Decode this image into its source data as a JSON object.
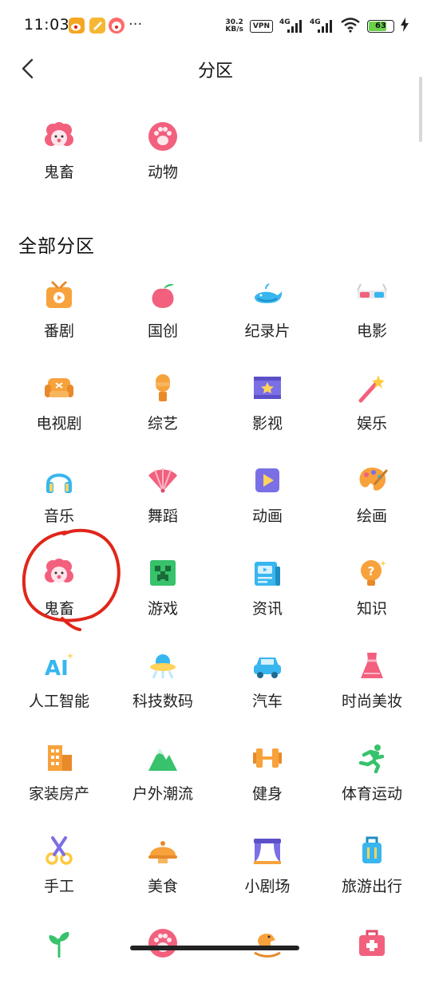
{
  "status_bar": {
    "time": "11:03",
    "more": "···",
    "net_speed_value": "30.2",
    "net_speed_unit": "KB/s",
    "vpn": "VPN",
    "signal_1": "4G",
    "signal_2": "4G",
    "battery": "63"
  },
  "header": {
    "title": "分区"
  },
  "recent": [
    {
      "label": "鬼畜",
      "icon": "ghost-clown-icon"
    },
    {
      "label": "动物",
      "icon": "paw-icon"
    }
  ],
  "all_section": {
    "title": "全部分区",
    "items": [
      {
        "label": "番剧",
        "icon": "tv-anime-icon"
      },
      {
        "label": "国创",
        "icon": "peach-icon"
      },
      {
        "label": "纪录片",
        "icon": "whale-icon"
      },
      {
        "label": "电影",
        "icon": "3d-glasses-icon"
      },
      {
        "label": "电视剧",
        "icon": "sofa-icon"
      },
      {
        "label": "综艺",
        "icon": "microphone-icon"
      },
      {
        "label": "影视",
        "icon": "film-icon"
      },
      {
        "label": "娱乐",
        "icon": "magic-wand-icon"
      },
      {
        "label": "音乐",
        "icon": "headphones-icon"
      },
      {
        "label": "舞蹈",
        "icon": "folding-fan-icon"
      },
      {
        "label": "动画",
        "icon": "play-box-icon"
      },
      {
        "label": "绘画",
        "icon": "palette-icon"
      },
      {
        "label": "鬼畜",
        "icon": "ghost-clown-icon"
      },
      {
        "label": "游戏",
        "icon": "creeper-icon"
      },
      {
        "label": "资讯",
        "icon": "newspaper-icon"
      },
      {
        "label": "知识",
        "icon": "lightbulb-icon"
      },
      {
        "label": "人工智能",
        "icon": "ai-icon"
      },
      {
        "label": "科技数码",
        "icon": "ufo-icon"
      },
      {
        "label": "汽车",
        "icon": "car-icon"
      },
      {
        "label": "时尚美妆",
        "icon": "dress-icon"
      },
      {
        "label": "家装房产",
        "icon": "building-icon"
      },
      {
        "label": "户外潮流",
        "icon": "mountain-icon"
      },
      {
        "label": "健身",
        "icon": "dumbbell-icon"
      },
      {
        "label": "体育运动",
        "icon": "runner-icon"
      },
      {
        "label": "手工",
        "icon": "scissors-icon"
      },
      {
        "label": "美食",
        "icon": "food-cloche-icon"
      },
      {
        "label": "小剧场",
        "icon": "stage-icon"
      },
      {
        "label": "旅游出行",
        "icon": "suitcase-icon"
      },
      {
        "label": "",
        "icon": "plant-icon"
      },
      {
        "label": "",
        "icon": "paw-icon"
      },
      {
        "label": "",
        "icon": "rocking-horse-icon"
      },
      {
        "label": "",
        "icon": "first-aid-icon"
      }
    ]
  },
  "colors": {
    "pink": "#f2607d",
    "orange": "#f7a23b",
    "blue": "#38b6f0",
    "purple": "#7b6fe6",
    "green": "#37c26b",
    "annotation_red": "#e0261a"
  }
}
